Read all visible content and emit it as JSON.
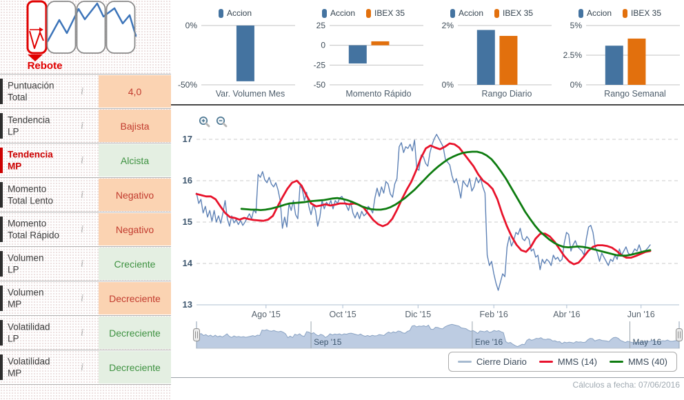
{
  "palette": {
    "series": {
      "Accion": "#4473a0",
      "IBEX 35": "#e2700d"
    },
    "negative_bg": "#fbd3b2",
    "negative_text": "#c23b2e",
    "positive_bg": "#e4efe2",
    "positive_text": "#3d9140",
    "highlight_red": "#cc0000",
    "grid": "#c9c9c9",
    "axis": "#aebfd2",
    "nav_fill": "#b6c6df",
    "nav_line": "#8aa3c3"
  },
  "pattern_selector": {
    "selected_label": "Rebote"
  },
  "sidebar": {
    "info_icon": "i",
    "rows": [
      {
        "label_lines": [
          "Puntuación",
          "Total"
        ],
        "value": "4,0",
        "tone": "neg",
        "highlighted": false
      },
      {
        "label_lines": [
          "Tendencia",
          "LP"
        ],
        "value": "Bajista",
        "tone": "neg",
        "highlighted": false
      },
      {
        "label_lines": [
          "Tendencia",
          "MP"
        ],
        "value": "Alcista",
        "tone": "pos",
        "highlighted": true
      },
      {
        "label_lines": [
          "Momento",
          "Total Lento"
        ],
        "value": "Negativo",
        "tone": "neg",
        "highlighted": false
      },
      {
        "label_lines": [
          "Momento",
          "Total Rápido"
        ],
        "value": "Negativo",
        "tone": "neg",
        "highlighted": false
      },
      {
        "label_lines": [
          "Volumen",
          "LP"
        ],
        "value": "Creciente",
        "tone": "pos",
        "highlighted": false
      },
      {
        "label_lines": [
          "Volumen",
          "MP"
        ],
        "value": "Decreciente",
        "tone": "neg",
        "highlighted": false
      },
      {
        "label_lines": [
          "Volatilidad",
          "LP"
        ],
        "value": "Decreciente",
        "tone": "pos",
        "highlighted": false
      },
      {
        "label_lines": [
          "Volatilidad",
          "MP"
        ],
        "value": "Decreciente",
        "tone": "pos",
        "highlighted": false
      }
    ]
  },
  "chart_data": {
    "mini": [
      {
        "type": "bar",
        "title": "Var. Volumen Mes",
        "legend": [
          "Accion"
        ],
        "ymax": 0,
        "ymin": -50,
        "yticks": [
          {
            "v": 0,
            "label": "0%"
          },
          {
            "v": -50,
            "label": "-50%"
          }
        ],
        "bars": [
          {
            "series": "Accion",
            "value": -47
          }
        ]
      },
      {
        "type": "bar",
        "title": "Momento Rápido",
        "legend": [
          "Accion",
          "IBEX 35"
        ],
        "ymax": 25,
        "ymin": -50,
        "yticks": [
          {
            "v": 25,
            "label": "25"
          },
          {
            "v": 0,
            "label": "0"
          },
          {
            "v": -25,
            "label": "-25"
          },
          {
            "v": -50,
            "label": "-50"
          }
        ],
        "bars": [
          {
            "series": "Accion",
            "value": -23
          },
          {
            "series": "IBEX 35",
            "value": 5
          }
        ]
      },
      {
        "type": "bar",
        "title": "Rango Diario",
        "legend": [
          "Accion",
          "IBEX 35"
        ],
        "ymax": 2,
        "ymin": 0,
        "yticks": [
          {
            "v": 2,
            "label": "2%"
          },
          {
            "v": 0,
            "label": "0%"
          }
        ],
        "bars": [
          {
            "series": "Accion",
            "value": 1.85
          },
          {
            "series": "IBEX 35",
            "value": 1.65
          }
        ]
      },
      {
        "type": "bar",
        "title": "Rango Semanal",
        "legend": [
          "Accion",
          "IBEX 35"
        ],
        "ymax": 5,
        "ymin": 0,
        "yticks": [
          {
            "v": 5,
            "label": "5%"
          },
          {
            "v": 2.5,
            "label": "2.5%"
          },
          {
            "v": 0,
            "label": "0%"
          }
        ],
        "bars": [
          {
            "series": "Accion",
            "value": 3.3
          },
          {
            "series": "IBEX 35",
            "value": 3.9
          }
        ]
      }
    ],
    "main": {
      "type": "line",
      "ylim": [
        13,
        17
      ],
      "yticks": [
        17,
        16,
        15,
        14,
        13
      ],
      "xticks": [
        {
          "f": 0.144,
          "label": "Ago '15"
        },
        {
          "f": 0.303,
          "label": "Oct '15"
        },
        {
          "f": 0.459,
          "label": "Dic '15"
        },
        {
          "f": 0.616,
          "label": "Feb '16"
        },
        {
          "f": 0.767,
          "label": "Abr '16"
        },
        {
          "f": 0.921,
          "label": "Jun '16"
        }
      ],
      "legend": [
        {
          "label": "Cierre Diario",
          "color": "#a6bad0"
        },
        {
          "label": "MMS (14)",
          "color": "#e8112d"
        },
        {
          "label": "MMS (40)",
          "color": "#0e7c10"
        }
      ],
      "navigator": {
        "labels": [
          {
            "f": 0.223,
            "label": "Sep '15"
          },
          {
            "f": 0.537,
            "label": "Ene '16"
          },
          {
            "f": 0.844,
            "label": "May '16"
          }
        ]
      },
      "series": [
        {
          "name": "Cierre Diario",
          "color": "#5d81b5",
          "width": 1.4,
          "x0": 0,
          "x1": 0.94,
          "values": [
            15.7,
            15.45,
            15.55,
            15.22,
            15.38,
            15.12,
            15.28,
            15.02,
            15.28,
            15.0,
            15.15,
            14.97,
            15.22,
            15.52,
            15.08,
            14.9,
            15.15,
            14.98,
            15.06,
            14.94,
            15.04,
            14.92,
            15.0,
            15.1,
            15.2,
            15.08,
            15.3,
            15.22,
            16.15,
            16.08,
            16.22,
            16.02,
            15.95,
            16.08,
            15.92,
            15.85,
            15.95,
            15.78,
            15.52,
            14.85,
            15.12,
            14.88,
            15.45,
            15.28,
            15.52,
            15.18,
            15.08,
            15.88,
            15.8,
            15.52,
            15.72,
            15.38,
            15.18,
            15.42,
            15.28,
            14.9,
            15.12,
            15.52,
            15.32,
            15.48,
            15.4,
            15.52,
            15.32,
            15.52,
            15.45,
            15.58,
            15.62,
            15.52,
            15.4,
            15.28,
            15.48,
            15.22,
            15.1,
            15.24,
            15.08,
            15.26,
            15.15,
            15.2,
            15.38,
            15.32,
            15.22,
            15.58,
            15.82,
            15.62,
            15.85,
            15.7,
            15.98,
            15.92,
            15.68,
            15.6,
            15.92,
            16.05,
            16.82,
            16.92,
            16.68,
            16.82,
            16.78,
            16.88,
            16.72,
            16.98,
            16.3,
            16.25,
            16.62,
            16.58,
            16.42,
            16.35,
            16.68,
            16.88,
            17.02,
            17.12,
            17.02,
            16.92,
            16.82,
            16.52,
            16.45,
            16.38,
            16.12,
            15.95,
            16.05,
            15.85,
            15.58,
            16.0,
            15.92,
            15.85,
            16.05,
            15.75,
            15.85,
            16.08,
            15.95,
            16.05,
            15.85,
            15.7,
            14.2,
            13.95,
            14.05,
            13.75,
            13.52,
            13.35,
            13.55,
            13.75,
            13.68,
            14.4,
            14.65,
            14.42,
            14.55,
            14.75,
            14.7,
            14.85,
            14.6,
            14.55,
            14.65,
            14.58,
            14.3,
            14.35,
            14.15,
            14.2,
            13.85,
            14.1,
            14.0,
            14.1,
            14.05,
            13.95,
            14.2,
            14.1,
            14.15,
            14.05,
            14.1,
            14.5,
            14.75,
            14.7,
            14.3,
            14.45,
            14.55,
            14.4,
            14.35,
            14.3,
            14.2,
            14.6,
            14.88,
            14.92,
            14.75,
            14.4,
            14.25,
            14.05,
            14.25,
            14.15,
            14.05,
            13.95,
            14.1,
            14.05,
            14.2,
            14.1,
            14.35,
            14.2,
            14.3,
            14.4,
            14.25,
            14.2,
            14.25,
            14.35,
            14.3,
            14.45,
            14.28,
            14.25,
            14.32,
            14.38,
            14.45
          ]
        },
        {
          "name": "MMS (14)",
          "color": "#e8132b",
          "width": 2.8,
          "x0": 0,
          "x1": 0.94,
          "values": [
            15.68,
            15.65,
            15.62,
            15.62,
            15.55,
            15.38,
            15.22,
            15.12,
            15.1,
            15.06,
            15.1,
            15.07,
            15.05,
            15.04,
            15.03,
            15.06,
            15.15,
            15.38,
            15.6,
            15.8,
            15.95,
            16.0,
            15.88,
            15.65,
            15.45,
            15.38,
            15.4,
            15.43,
            15.4,
            15.42,
            15.45,
            15.45,
            15.43,
            15.45,
            15.42,
            15.35,
            15.2,
            15.05,
            14.95,
            14.9,
            14.95,
            15.08,
            15.3,
            15.55,
            15.78,
            15.98,
            16.25,
            16.55,
            16.78,
            16.85,
            16.8,
            16.76,
            16.82,
            16.9,
            16.88,
            16.8,
            16.65,
            16.5,
            16.35,
            16.15,
            16.0,
            15.92,
            15.8,
            15.55,
            15.2,
            14.9,
            14.65,
            14.45,
            14.32,
            14.28,
            14.4,
            14.6,
            14.72,
            14.72,
            14.65,
            14.52,
            14.35,
            14.18,
            14.05,
            13.98,
            14.02,
            14.15,
            14.3,
            14.4,
            14.44,
            14.44,
            14.42,
            14.38,
            14.3,
            14.2,
            14.14,
            14.14,
            14.18,
            14.23,
            14.28,
            14.3
          ]
        },
        {
          "name": "MMS (40)",
          "color": "#0e7c10",
          "width": 2.8,
          "x0": 0.093,
          "x1": 0.94,
          "values": [
            15.32,
            15.31,
            15.3,
            15.3,
            15.29,
            15.3,
            15.32,
            15.35,
            15.38,
            15.42,
            15.45,
            15.46,
            15.47,
            15.48,
            15.5,
            15.51,
            15.52,
            15.53,
            15.55,
            15.57,
            15.58,
            15.56,
            15.53,
            15.49,
            15.44,
            15.38,
            15.34,
            15.31,
            15.3,
            15.3,
            15.32,
            15.36,
            15.42,
            15.5,
            15.58,
            15.68,
            15.78,
            15.9,
            16.02,
            16.14,
            16.25,
            16.35,
            16.44,
            16.52,
            16.58,
            16.63,
            16.67,
            16.69,
            16.7,
            16.7,
            16.67,
            16.61,
            16.52,
            16.38,
            16.22,
            16.05,
            15.85,
            15.65,
            15.45,
            15.25,
            15.08,
            14.92,
            14.78,
            14.68,
            14.58,
            14.5,
            14.44,
            14.4,
            14.39,
            14.4,
            14.41,
            14.4,
            14.38,
            14.35,
            14.32,
            14.29,
            14.26,
            14.23,
            14.2,
            14.19,
            14.19,
            14.21,
            14.24,
            14.27,
            14.3,
            14.32
          ]
        }
      ]
    }
  },
  "footer": {
    "text": "Cálculos a fecha: 07/06/2016"
  }
}
